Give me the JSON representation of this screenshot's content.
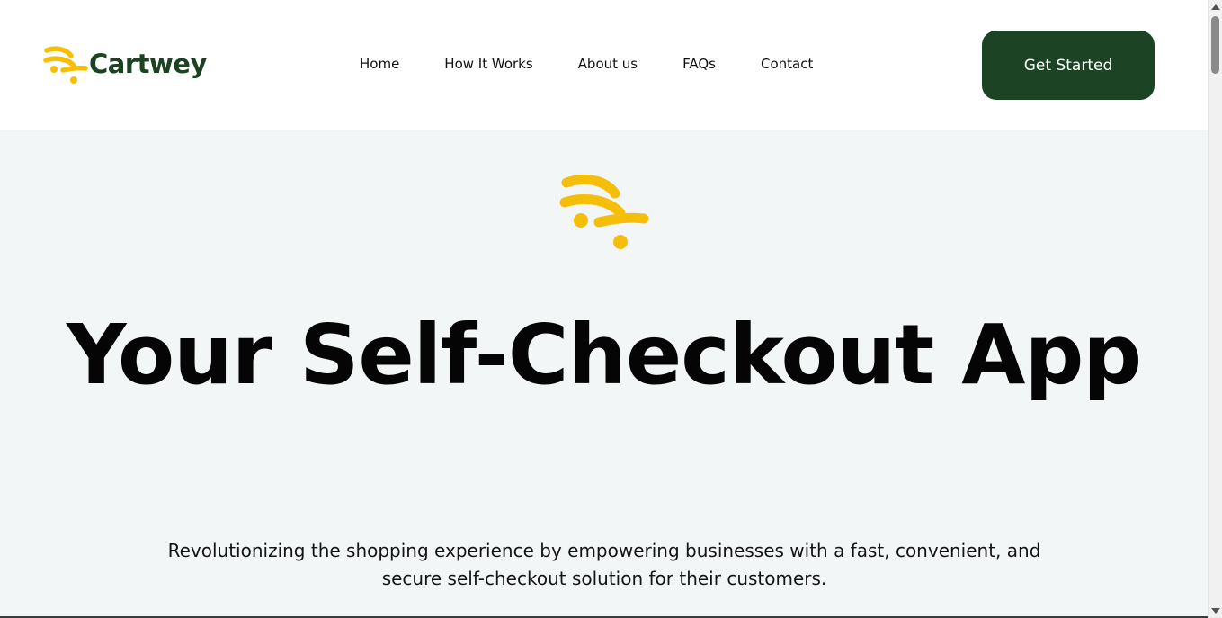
{
  "brand": {
    "name": "Cartwey",
    "text_color": "#1b4321",
    "mark_color": "#f5bf09"
  },
  "nav": {
    "items": [
      {
        "label": "Home"
      },
      {
        "label": "How It Works"
      },
      {
        "label": "About us"
      },
      {
        "label": "FAQs"
      },
      {
        "label": "Contact"
      }
    ]
  },
  "header": {
    "cta_label": "Get Started",
    "cta_color": "#1c4424"
  },
  "hero": {
    "title": "Your Self-Checkout App",
    "subtitle": "Revolutionizing the shopping experience by empowering businesses with a fast, convenient, and secure self-checkout solution for their customers.",
    "background": "#f3f6f7",
    "icon": "cart-wave-logo-icon"
  }
}
